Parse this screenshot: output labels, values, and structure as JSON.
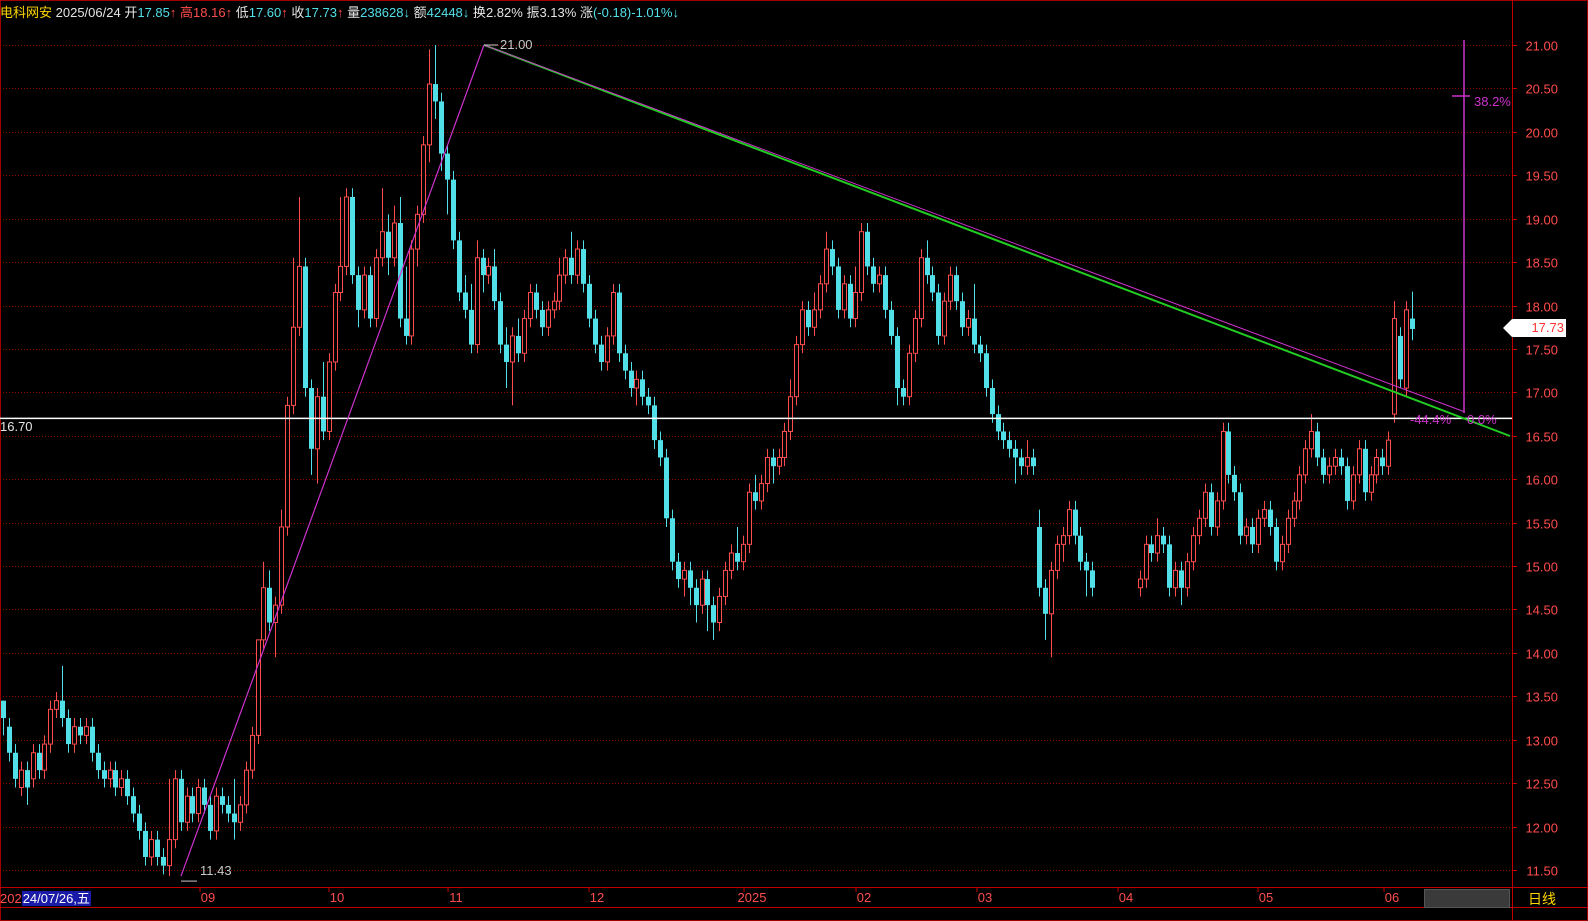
{
  "quote_bar": {
    "name": "电科网安",
    "date": "2025/06/24",
    "open_label": "开",
    "open_value": "17.85",
    "open_arrow": "↑",
    "high_label": "高",
    "high_value": "18.16",
    "high_arrow": "↑",
    "low_label": "低",
    "low_value": "17.60",
    "low_arrow": "↑",
    "close_label": "收",
    "close_value": "17.73",
    "close_arrow": "↑",
    "volume_label": "量",
    "volume_value": "238628",
    "volume_arrow": "↓",
    "amount_label": "额",
    "amount_value": "42448",
    "amount_arrow": "↓",
    "turnover_label": "换",
    "turnover_value": "2.82%",
    "amplitude_label": "振",
    "amplitude_value": "3.13%",
    "change_label": "涨",
    "change_value": "(-0.18)-1.01%",
    "change_arrow": "↓"
  },
  "price_axis": [
    "21.00",
    "20.50",
    "20.00",
    "19.50",
    "19.00",
    "18.50",
    "18.00",
    "17.50",
    "17.00",
    "16.50",
    "16.00",
    "15.50",
    "15.00",
    "14.50",
    "14.00",
    "13.50",
    "13.00",
    "12.50",
    "12.00",
    "11.50"
  ],
  "time_axis": [
    "09",
    "10",
    "11",
    "12",
    "2025",
    "02",
    "03",
    "04",
    "05",
    "06"
  ],
  "cursor_date": {
    "prefix": "202",
    "date": "24/07/26,五"
  },
  "period": "日线",
  "last_price": "17.73",
  "horizontal_level": "16.70",
  "annotations": {
    "high_mark": "21.00",
    "low_mark": "11.43",
    "fib_382": "38.2%",
    "fib_neg": "-44.4%",
    "fib_zero": "0.0%"
  },
  "colors": {
    "up": "#ff4d4d",
    "down": "#52e0e8",
    "grid": "#8b0000",
    "trendline_green": "#22cc22",
    "trendline_magenta": "#cc33cc",
    "level_line": "#ffffff"
  },
  "chart_data": {
    "type": "candlestick",
    "ylim": [
      11.3,
      21.15
    ],
    "trend_lines": [
      {
        "from": [
          "2024-08-26",
          11.43
        ],
        "to": [
          "2024-11-07",
          21.0
        ]
      },
      {
        "from": [
          "2024-11-07",
          21.0
        ],
        "to": [
          "2025-06-24",
          16.52
        ]
      }
    ],
    "level": 16.7,
    "candles": [
      [
        13.45,
        13.25,
        13.45,
        13.05
      ],
      [
        13.15,
        12.85,
        13.25,
        12.75
      ],
      [
        12.85,
        12.55,
        12.95,
        12.45
      ],
      [
        12.45,
        12.65,
        12.75,
        12.35
      ],
      [
        12.65,
        12.45,
        12.75,
        12.25
      ],
      [
        12.55,
        12.85,
        12.95,
        12.45
      ],
      [
        12.85,
        12.65,
        12.95,
        12.55
      ],
      [
        12.65,
        12.95,
        13.05,
        12.55
      ],
      [
        12.95,
        13.35,
        13.45,
        12.85
      ],
      [
        13.35,
        13.45,
        13.55,
        13.25
      ],
      [
        13.45,
        13.25,
        13.85,
        13.15
      ],
      [
        13.25,
        12.95,
        13.35,
        12.85
      ],
      [
        12.95,
        13.15,
        13.25,
        12.85
      ],
      [
        13.15,
        13.05,
        13.25,
        12.95
      ],
      [
        13.05,
        13.15,
        13.25,
        12.95
      ],
      [
        13.15,
        12.85,
        13.25,
        12.75
      ],
      [
        12.85,
        12.65,
        12.95,
        12.55
      ],
      [
        12.65,
        12.55,
        12.75,
        12.45
      ],
      [
        12.55,
        12.65,
        12.75,
        12.45
      ],
      [
        12.65,
        12.45,
        12.75,
        12.35
      ],
      [
        12.45,
        12.55,
        12.65,
        12.35
      ],
      [
        12.55,
        12.35,
        12.65,
        12.25
      ],
      [
        12.35,
        12.15,
        12.45,
        12.05
      ],
      [
        12.15,
        11.95,
        12.25,
        11.85
      ],
      [
        11.95,
        11.65,
        12.05,
        11.55
      ],
      [
        11.65,
        11.85,
        11.95,
        11.55
      ],
      [
        11.85,
        11.65,
        11.95,
        11.55
      ],
      [
        11.65,
        11.55,
        11.75,
        11.45
      ],
      [
        11.55,
        11.85,
        12.55,
        11.43
      ],
      [
        11.85,
        12.55,
        12.65,
        11.75
      ],
      [
        12.55,
        12.05,
        12.65,
        11.95
      ],
      [
        12.05,
        12.35,
        12.45,
        11.95
      ],
      [
        12.35,
        12.15,
        12.45,
        12.05
      ],
      [
        12.15,
        12.45,
        12.55,
        12.05
      ],
      [
        12.45,
        12.25,
        12.55,
        12.15
      ],
      [
        12.25,
        11.95,
        12.35,
        11.85
      ],
      [
        11.95,
        12.35,
        12.45,
        11.85
      ],
      [
        12.35,
        12.25,
        12.45,
        12.15
      ],
      [
        12.25,
        12.15,
        12.35,
        12.05
      ],
      [
        12.15,
        12.05,
        12.55,
        11.85
      ],
      [
        12.05,
        12.25,
        12.35,
        11.95
      ],
      [
        12.25,
        12.65,
        12.75,
        12.15
      ],
      [
        12.65,
        13.05,
        13.15,
        12.55
      ],
      [
        13.05,
        14.15,
        14.15,
        12.95
      ],
      [
        14.15,
        14.75,
        15.05,
        14.05
      ],
      [
        14.75,
        14.35,
        14.95,
        14.25
      ],
      [
        14.35,
        14.55,
        14.65,
        13.95
      ],
      [
        14.55,
        15.45,
        15.65,
        14.45
      ],
      [
        15.45,
        16.85,
        16.95,
        15.35
      ],
      [
        16.85,
        17.75,
        18.55,
        16.75
      ],
      [
        17.75,
        18.45,
        19.25,
        17.65
      ],
      [
        18.45,
        17.05,
        18.55,
        16.95
      ],
      [
        17.05,
        16.35,
        17.15,
        16.05
      ],
      [
        16.35,
        16.95,
        17.05,
        15.95
      ],
      [
        16.95,
        16.55,
        17.35,
        16.45
      ],
      [
        16.55,
        17.35,
        17.45,
        16.45
      ],
      [
        17.35,
        18.15,
        18.25,
        17.25
      ],
      [
        18.15,
        18.45,
        19.25,
        18.05
      ],
      [
        18.45,
        19.25,
        19.35,
        18.35
      ],
      [
        19.25,
        18.35,
        19.35,
        18.25
      ],
      [
        18.35,
        17.95,
        18.45,
        17.75
      ],
      [
        17.95,
        18.35,
        18.45,
        17.85
      ],
      [
        18.35,
        17.85,
        18.45,
        17.75
      ],
      [
        17.85,
        18.55,
        18.65,
        17.75
      ],
      [
        18.55,
        18.85,
        19.35,
        18.45
      ],
      [
        18.85,
        18.55,
        19.05,
        18.35
      ],
      [
        18.55,
        18.95,
        19.15,
        18.45
      ],
      [
        18.95,
        17.85,
        19.25,
        17.75
      ],
      [
        17.85,
        17.65,
        18.45,
        17.55
      ],
      [
        17.65,
        18.65,
        18.75,
        17.55
      ],
      [
        18.65,
        19.05,
        19.15,
        18.45
      ],
      [
        19.05,
        19.85,
        19.95,
        18.95
      ],
      [
        19.85,
        20.55,
        20.95,
        19.65
      ],
      [
        20.55,
        20.35,
        21.0,
        20.15
      ],
      [
        20.35,
        19.75,
        20.45,
        19.55
      ],
      [
        19.75,
        19.45,
        19.85,
        19.05
      ],
      [
        19.45,
        18.75,
        19.55,
        18.65
      ],
      [
        18.75,
        18.15,
        18.85,
        18.05
      ],
      [
        18.15,
        17.95,
        18.35,
        17.85
      ],
      [
        17.95,
        17.55,
        18.25,
        17.45
      ],
      [
        17.55,
        18.55,
        18.75,
        17.45
      ],
      [
        18.55,
        18.35,
        18.65,
        18.15
      ],
      [
        18.35,
        18.45,
        18.55,
        18.25
      ],
      [
        18.45,
        18.05,
        18.65,
        17.95
      ],
      [
        18.05,
        17.55,
        18.15,
        17.45
      ],
      [
        17.55,
        17.35,
        17.75,
        17.05
      ],
      [
        17.35,
        17.65,
        17.75,
        16.85
      ],
      [
        17.65,
        17.45,
        17.85,
        17.35
      ],
      [
        17.45,
        17.85,
        17.95,
        17.35
      ],
      [
        17.85,
        18.15,
        18.25,
        17.75
      ],
      [
        18.15,
        17.95,
        18.25,
        17.85
      ],
      [
        17.95,
        17.75,
        18.05,
        17.65
      ],
      [
        17.75,
        17.95,
        18.05,
        17.65
      ],
      [
        17.95,
        18.05,
        18.15,
        17.85
      ],
      [
        18.05,
        18.35,
        18.55,
        17.95
      ],
      [
        18.35,
        18.55,
        18.65,
        18.25
      ],
      [
        18.55,
        18.35,
        18.85,
        18.25
      ],
      [
        18.35,
        18.65,
        18.75,
        18.25
      ],
      [
        18.65,
        18.25,
        18.75,
        18.15
      ],
      [
        18.25,
        17.85,
        18.35,
        17.75
      ],
      [
        17.85,
        17.55,
        17.95,
        17.45
      ],
      [
        17.55,
        17.35,
        17.65,
        17.25
      ],
      [
        17.35,
        17.65,
        17.75,
        17.25
      ],
      [
        17.65,
        18.15,
        18.25,
        17.55
      ],
      [
        18.15,
        17.45,
        18.25,
        17.35
      ],
      [
        17.45,
        17.25,
        17.55,
        17.15
      ],
      [
        17.25,
        17.05,
        17.35,
        16.95
      ],
      [
        17.05,
        17.15,
        17.25,
        16.85
      ],
      [
        17.15,
        16.95,
        17.25,
        16.85
      ],
      [
        16.95,
        16.85,
        17.05,
        16.75
      ],
      [
        16.85,
        16.45,
        16.95,
        16.35
      ],
      [
        16.45,
        16.25,
        16.55,
        16.15
      ],
      [
        16.25,
        15.55,
        16.35,
        15.45
      ],
      [
        15.55,
        15.05,
        15.65,
        14.95
      ],
      [
        15.05,
        14.85,
        15.15,
        14.75
      ],
      [
        14.85,
        14.95,
        15.05,
        14.65
      ],
      [
        14.95,
        14.75,
        15.05,
        14.55
      ],
      [
        14.75,
        14.55,
        14.85,
        14.35
      ],
      [
        14.55,
        14.85,
        14.95,
        14.45
      ],
      [
        14.85,
        14.55,
        14.95,
        14.25
      ],
      [
        14.55,
        14.35,
        14.65,
        14.15
      ],
      [
        14.35,
        14.65,
        14.75,
        14.25
      ],
      [
        14.65,
        14.95,
        15.05,
        14.55
      ],
      [
        14.95,
        15.15,
        15.25,
        14.85
      ],
      [
        15.15,
        15.05,
        15.45,
        14.95
      ],
      [
        15.05,
        15.25,
        15.35,
        14.95
      ],
      [
        15.25,
        15.85,
        15.95,
        15.15
      ],
      [
        15.85,
        15.75,
        16.05,
        15.65
      ],
      [
        15.75,
        15.95,
        16.05,
        15.65
      ],
      [
        15.95,
        16.25,
        16.35,
        15.85
      ],
      [
        16.25,
        16.15,
        16.35,
        15.95
      ],
      [
        16.15,
        16.25,
        16.35,
        16.05
      ],
      [
        16.25,
        16.55,
        16.65,
        16.15
      ],
      [
        16.55,
        16.95,
        17.15,
        16.45
      ],
      [
        16.95,
        17.55,
        17.65,
        16.85
      ],
      [
        17.55,
        17.95,
        18.05,
        17.45
      ],
      [
        17.95,
        17.75,
        18.05,
        17.65
      ],
      [
        17.75,
        17.95,
        18.15,
        17.65
      ],
      [
        17.95,
        18.25,
        18.35,
        17.85
      ],
      [
        18.25,
        18.65,
        18.85,
        18.15
      ],
      [
        18.65,
        18.45,
        18.75,
        18.35
      ],
      [
        18.45,
        17.95,
        18.55,
        17.85
      ],
      [
        17.95,
        18.25,
        18.35,
        17.85
      ],
      [
        18.25,
        17.85,
        18.35,
        17.75
      ],
      [
        17.85,
        18.15,
        18.45,
        17.75
      ],
      [
        18.15,
        18.85,
        18.95,
        18.05
      ],
      [
        18.85,
        18.45,
        18.95,
        18.35
      ],
      [
        18.45,
        18.25,
        18.55,
        18.15
      ],
      [
        18.25,
        18.35,
        18.45,
        18.15
      ],
      [
        18.35,
        17.95,
        18.45,
        17.85
      ],
      [
        17.95,
        17.65,
        18.05,
        17.55
      ],
      [
        17.65,
        17.05,
        17.75,
        16.85
      ],
      [
        17.05,
        16.95,
        17.15,
        16.85
      ],
      [
        16.95,
        17.45,
        17.55,
        16.85
      ],
      [
        17.45,
        17.85,
        17.95,
        17.35
      ],
      [
        17.85,
        18.55,
        18.65,
        17.75
      ],
      [
        18.55,
        18.35,
        18.75,
        18.25
      ],
      [
        18.35,
        18.15,
        18.45,
        18.05
      ],
      [
        18.15,
        17.65,
        18.25,
        17.55
      ],
      [
        17.65,
        18.05,
        18.15,
        17.55
      ],
      [
        18.05,
        18.35,
        18.45,
        17.95
      ],
      [
        18.35,
        18.05,
        18.45,
        17.95
      ],
      [
        18.05,
        17.75,
        18.15,
        17.65
      ],
      [
        17.75,
        17.85,
        17.95,
        17.65
      ],
      [
        17.85,
        17.55,
        18.25,
        17.45
      ],
      [
        17.55,
        17.45,
        17.65,
        17.35
      ],
      [
        17.45,
        17.05,
        17.55,
        16.95
      ],
      [
        17.05,
        16.75,
        17.15,
        16.65
      ],
      [
        16.75,
        16.55,
        16.85,
        16.45
      ],
      [
        16.55,
        16.45,
        16.65,
        16.35
      ],
      [
        16.45,
        16.35,
        16.55,
        16.25
      ],
      [
        16.35,
        16.25,
        16.45,
        15.95
      ],
      [
        16.25,
        16.15,
        16.35,
        16.05
      ],
      [
        16.15,
        16.25,
        16.45,
        16.05
      ],
      [
        16.25,
        16.15,
        16.35,
        16.05
      ],
      [
        15.45,
        14.75,
        15.65,
        14.65
      ],
      [
        14.75,
        14.45,
        14.85,
        14.15
      ],
      [
        14.45,
        14.95,
        15.05,
        13.95
      ],
      [
        14.95,
        15.25,
        15.35,
        14.85
      ],
      [
        15.25,
        15.35,
        15.45,
        15.05
      ],
      [
        15.35,
        15.65,
        15.75,
        15.25
      ],
      [
        15.65,
        15.35,
        15.75,
        15.25
      ],
      [
        15.35,
        15.05,
        15.45,
        14.95
      ],
      [
        15.05,
        14.95,
        15.15,
        14.65
      ],
      [
        14.95,
        14.75,
        15.05,
        14.65
      ],
      [
        14.75,
        14.85,
        14.95,
        14.65
      ],
      [
        14.85,
        15.25,
        15.35,
        14.75
      ],
      [
        15.25,
        15.15,
        15.35,
        15.05
      ],
      [
        15.15,
        15.35,
        15.55,
        15.05
      ],
      [
        15.35,
        15.25,
        15.45,
        15.15
      ],
      [
        15.25,
        14.75,
        15.35,
        14.65
      ],
      [
        14.75,
        14.95,
        15.05,
        14.65
      ],
      [
        14.95,
        14.75,
        15.05,
        14.55
      ],
      [
        14.75,
        15.05,
        15.15,
        14.65
      ],
      [
        15.05,
        15.35,
        15.45,
        14.95
      ],
      [
        15.35,
        15.55,
        15.65,
        15.25
      ],
      [
        15.55,
        15.85,
        15.95,
        15.45
      ],
      [
        15.85,
        15.45,
        15.95,
        15.35
      ],
      [
        15.45,
        15.75,
        15.85,
        15.35
      ],
      [
        15.75,
        16.55,
        16.65,
        15.65
      ],
      [
        16.55,
        16.05,
        16.65,
        15.95
      ],
      [
        16.05,
        15.85,
        16.15,
        15.75
      ],
      [
        15.85,
        15.35,
        15.95,
        15.25
      ],
      [
        15.35,
        15.45,
        15.55,
        15.25
      ],
      [
        15.45,
        15.25,
        15.55,
        15.15
      ],
      [
        15.25,
        15.55,
        15.65,
        15.15
      ],
      [
        15.55,
        15.65,
        15.75,
        15.45
      ],
      [
        15.65,
        15.45,
        15.75,
        15.35
      ],
      [
        15.45,
        15.05,
        15.55,
        14.95
      ],
      [
        15.05,
        15.25,
        15.35,
        14.95
      ],
      [
        15.25,
        15.55,
        15.65,
        15.15
      ],
      [
        15.55,
        15.75,
        15.85,
        15.45
      ],
      [
        15.75,
        16.05,
        16.15,
        15.65
      ],
      [
        16.05,
        16.35,
        16.45,
        15.95
      ],
      [
        16.35,
        16.55,
        16.75,
        16.25
      ],
      [
        16.55,
        16.25,
        16.65,
        16.15
      ],
      [
        16.25,
        16.05,
        16.35,
        15.95
      ],
      [
        16.05,
        16.15,
        16.25,
        15.95
      ],
      [
        16.15,
        16.25,
        16.35,
        16.05
      ],
      [
        16.25,
        16.15,
        16.35,
        16.05
      ],
      [
        16.15,
        15.75,
        16.25,
        15.65
      ],
      [
        15.75,
        16.05,
        16.15,
        15.65
      ],
      [
        16.05,
        16.35,
        16.45,
        15.95
      ],
      [
        16.35,
        15.85,
        16.45,
        15.75
      ],
      [
        15.85,
        16.05,
        16.15,
        15.75
      ],
      [
        16.05,
        16.25,
        16.35,
        15.95
      ],
      [
        16.25,
        16.15,
        16.35,
        16.05
      ],
      [
        16.15,
        16.45,
        16.55,
        16.05
      ],
      [
        16.75,
        17.85,
        18.05,
        16.65
      ],
      [
        17.65,
        17.15,
        17.75,
        17.05
      ],
      [
        17.05,
        17.95,
        18.05,
        16.95
      ],
      [
        17.85,
        17.73,
        18.16,
        17.6
      ]
    ]
  }
}
